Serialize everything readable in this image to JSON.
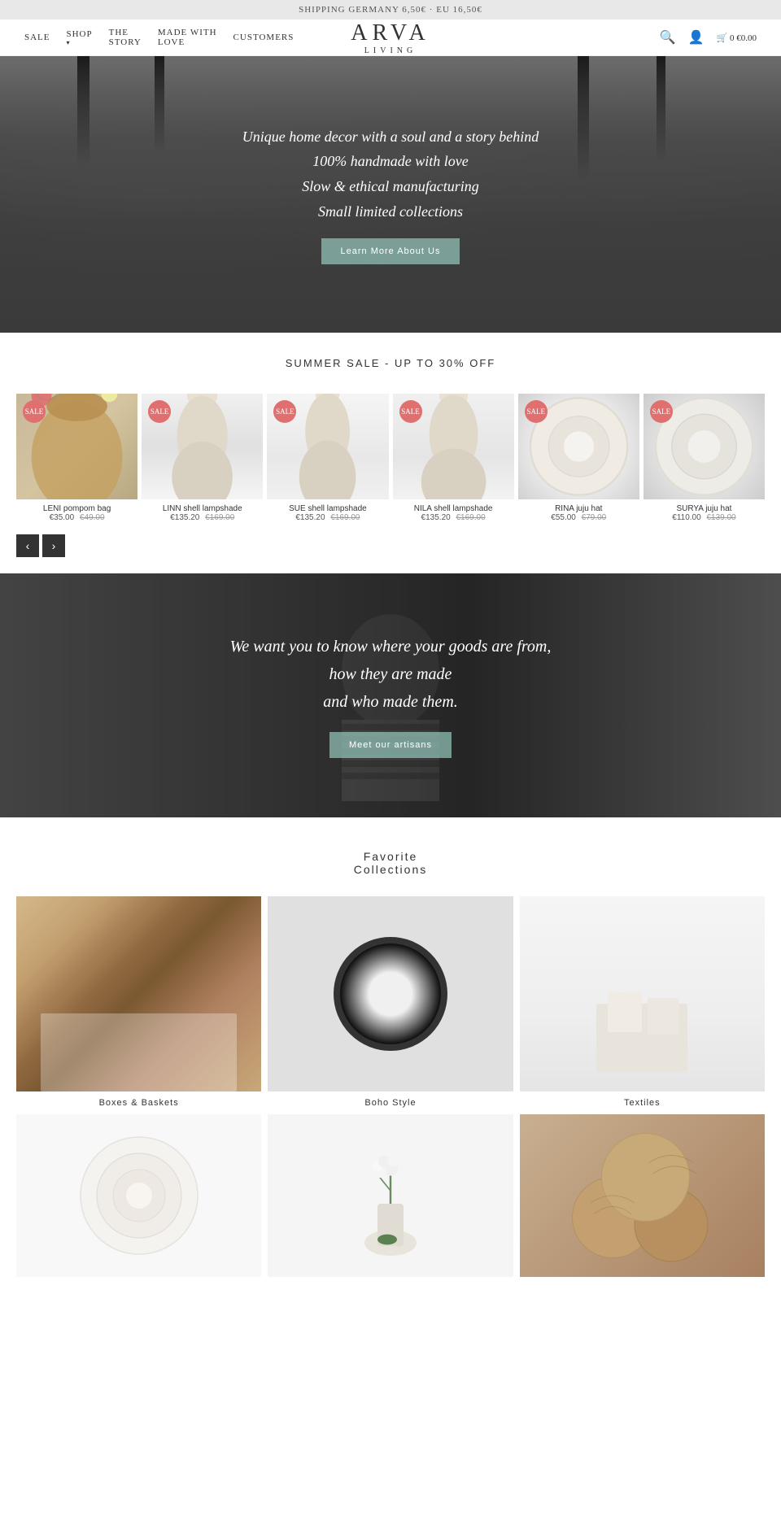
{
  "topBanner": {
    "text": "SHIPPING GERMANY 6,50€ · EU 16,50€"
  },
  "nav": {
    "sale": "SALE",
    "shop": "SHOP",
    "shopArrow": "▾",
    "the": "THE",
    "story": "STORY",
    "madeWith": "MADE WITH",
    "love": "LOVE",
    "customers": "CUSTOMERS",
    "logoMain": "ARVA",
    "logoSub": "LIVING"
  },
  "hero": {
    "line1": "Unique home decor with a soul and a story behind",
    "line2": "100% handmade with love",
    "line3": "Slow & ethical manufacturing",
    "line4": "Small limited collections",
    "btnText": "Learn More About Us"
  },
  "saleSection": {
    "title": "SUMMER SALE - UP TO 30% OFF"
  },
  "products": [
    {
      "name": "LENI pompom bag",
      "priceNew": "€35.00",
      "priceOld": "€49.00",
      "badge": "SALE",
      "imgClass": "img-pompom"
    },
    {
      "name": "LINN shell lampshade",
      "priceNew": "€135.20",
      "priceOld": "€169.00",
      "badge": "SALE",
      "imgClass": "img-shell1"
    },
    {
      "name": "SUE shell lampshade",
      "priceNew": "€135.20",
      "priceOld": "€169.00",
      "badge": "SALE",
      "imgClass": "img-shell2"
    },
    {
      "name": "NILA shell lampshade",
      "priceNew": "€135.20",
      "priceOld": "€169.00",
      "badge": "SALE",
      "imgClass": "img-shell3"
    },
    {
      "name": "RINA juju hat",
      "priceNew": "€55.00",
      "priceOld": "€79.00",
      "badge": "SALE",
      "imgClass": "img-juju1"
    },
    {
      "name": "SURYA juju hat",
      "priceNew": "€110.00",
      "priceOld": "€139.00",
      "badge": "SALE",
      "imgClass": "img-juju2"
    }
  ],
  "carousel": {
    "prevLabel": "‹",
    "nextLabel": "›"
  },
  "artisan": {
    "line1": "We want you to know where your goods are from,",
    "line2": "how they are made",
    "line3": "and who made them.",
    "btnText": "Meet our artisans"
  },
  "collections": {
    "title": "Favorite\nCollections",
    "items": [
      {
        "label": "Boxes & Baskets",
        "imgClass": "col-boxes"
      },
      {
        "label": "Boho Style",
        "imgClass": "col-boho"
      },
      {
        "label": "Textiles",
        "imgClass": "col-textiles"
      },
      {
        "label": "",
        "imgClass": "col-juju"
      },
      {
        "label": "",
        "imgClass": "col-flowers"
      },
      {
        "label": "",
        "imgClass": "col-balls"
      }
    ]
  }
}
